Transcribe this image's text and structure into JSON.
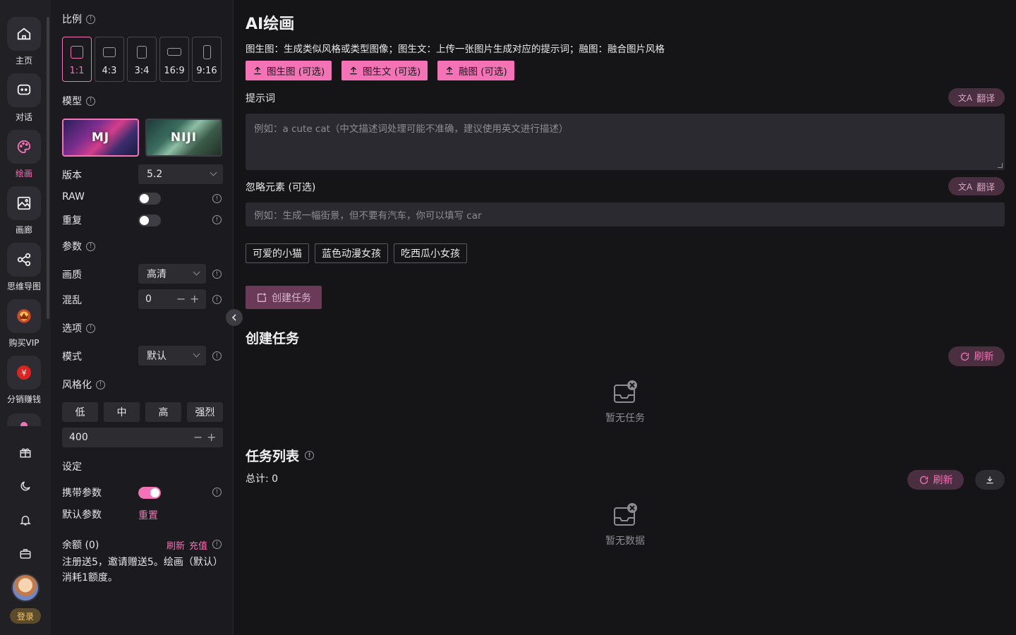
{
  "nav": {
    "items": [
      {
        "label": "主页",
        "icon": "home-icon"
      },
      {
        "label": "对话",
        "icon": "chat-icon"
      },
      {
        "label": "绘画",
        "icon": "palette-icon"
      },
      {
        "label": "画廊",
        "icon": "gallery-icon"
      },
      {
        "label": "思维导图",
        "icon": "mindmap-icon"
      },
      {
        "label": "购买VIP",
        "icon": "vip-icon"
      },
      {
        "label": "分销赚钱",
        "icon": "distribution-icon"
      }
    ],
    "active": "绘画",
    "login_label": "登录"
  },
  "panel": {
    "ratio": {
      "label": "比例",
      "options": [
        "1:1",
        "4:3",
        "3:4",
        "16:9",
        "9:16"
      ],
      "selected": "1:1"
    },
    "model": {
      "label": "模型",
      "options": [
        "MJ",
        "NIJI"
      ],
      "selected": "MJ"
    },
    "version": {
      "label": "版本",
      "value": "5.2"
    },
    "raw": {
      "label": "RAW",
      "on": false
    },
    "repeat": {
      "label": "重复",
      "on": false
    },
    "params_label": "参数",
    "quality": {
      "label": "画质",
      "value": "高清"
    },
    "chaos": {
      "label": "混乱",
      "value": "0"
    },
    "options_label": "选项",
    "mode": {
      "label": "模式",
      "value": "默认"
    },
    "stylize": {
      "label": "风格化",
      "levels": [
        "低",
        "中",
        "高",
        "强烈"
      ],
      "value": "400"
    },
    "settings_label": "设定",
    "carry_params": {
      "label": "携带参数",
      "on": true
    },
    "default_params": {
      "label": "默认参数",
      "reset": "重置"
    },
    "balance": {
      "label": "余额 (0)",
      "refresh": "刷新",
      "recharge": "充值"
    },
    "note": "注册送5，邀请赠送5。绘画（默认）消耗1额度。"
  },
  "main": {
    "title": "AI绘画",
    "description": "图生图：生成类似风格或类型图像；图生文：上传一张图片生成对应的提示词；融图：融合图片风格",
    "uploads": [
      "图生图 (可选)",
      "图生文 (可选)",
      "融图 (可选)"
    ],
    "prompt": {
      "label": "提示词",
      "placeholder": "例如：a cute cat（中文描述词处理可能不准确，建议使用英文进行描述）",
      "translate": "翻译"
    },
    "negative": {
      "label": "忽略元素 (可选)",
      "placeholder": "例如：生成一幅街景，但不要有汽车，你可以填写 car",
      "translate": "翻译"
    },
    "examples": [
      "可爱的小猫",
      "蓝色动漫女孩",
      "吃西瓜小女孩"
    ],
    "create_button": "创建任务",
    "create_section": {
      "title": "创建任务",
      "refresh": "刷新",
      "empty": "暂无任务"
    },
    "task_list": {
      "title": "任务列表",
      "refresh": "刷新",
      "total": "总计: 0",
      "empty": "暂无数据"
    }
  },
  "colors": {
    "accent": "#f472b6",
    "bg": "#151417",
    "panel": "#1b1a1e",
    "rail": "#212024"
  }
}
